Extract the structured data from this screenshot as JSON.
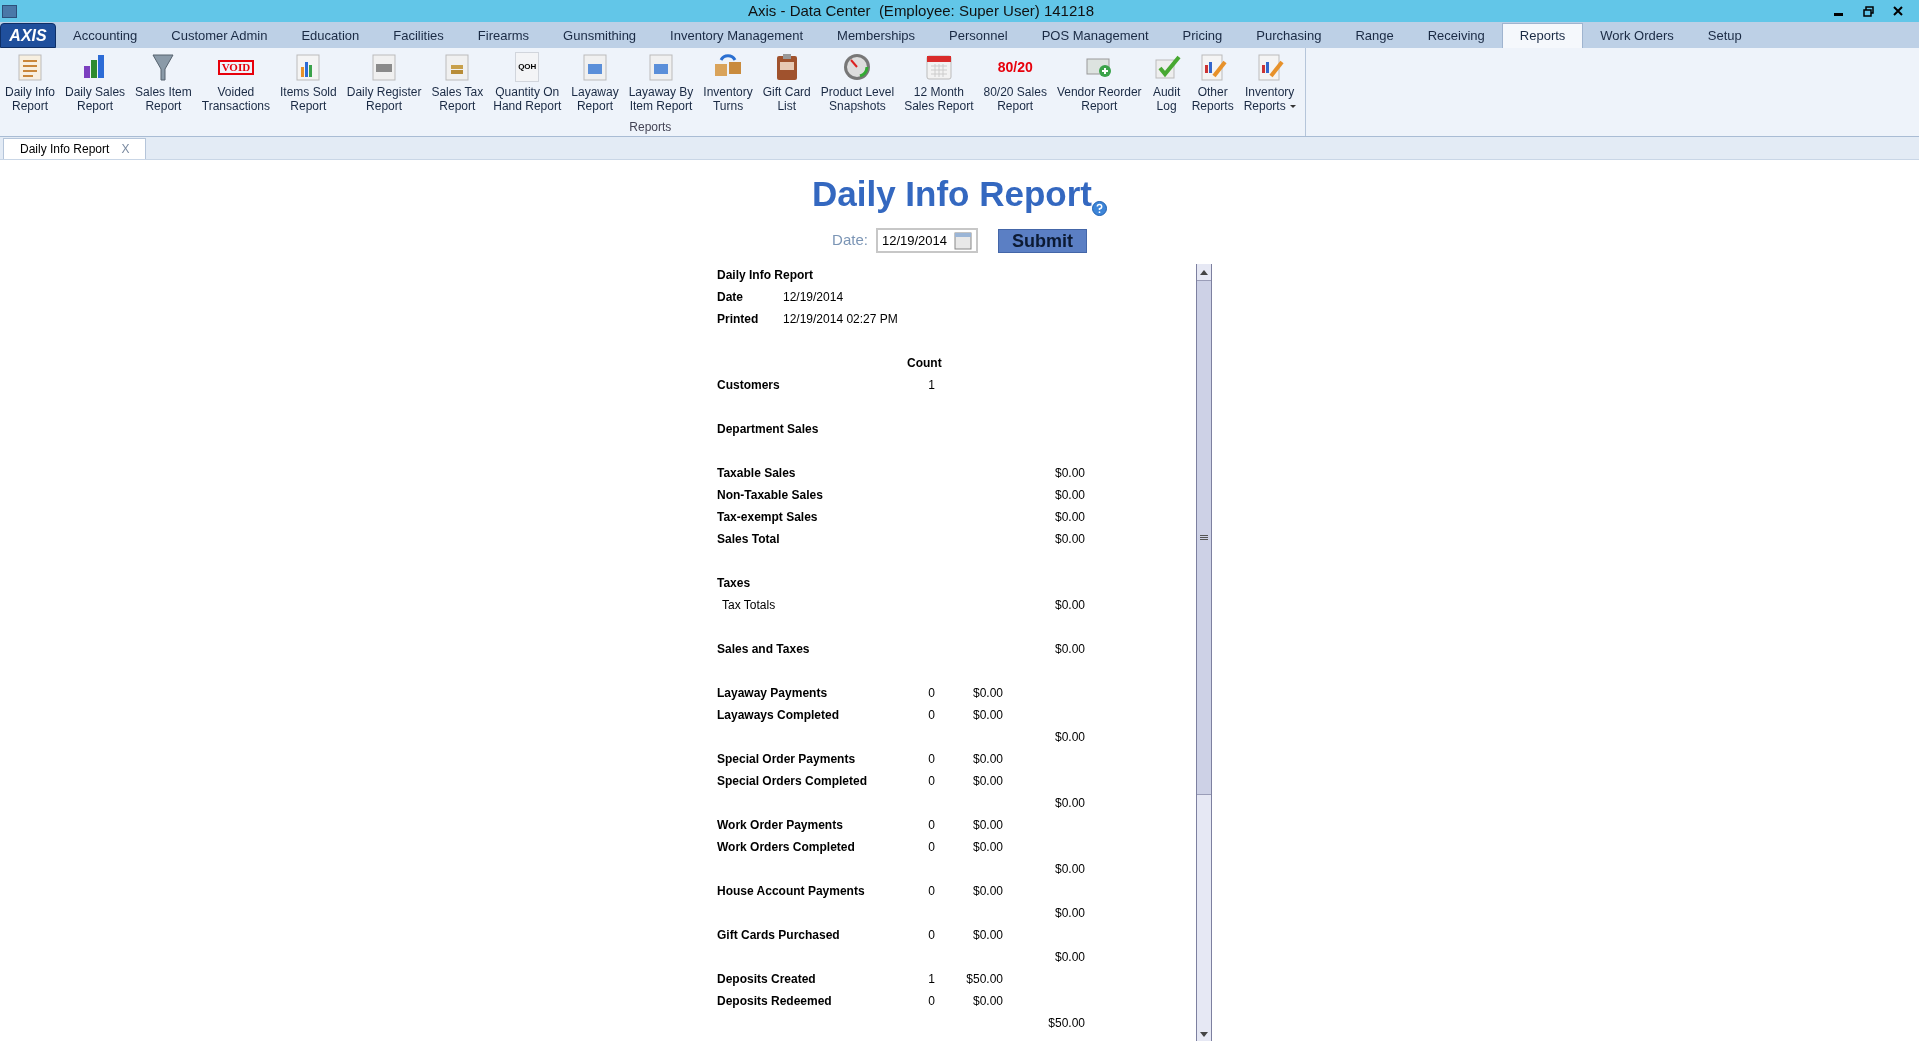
{
  "window": {
    "title": "Axis - Data Center  (Employee: Super User) 141218",
    "logo": "AXIS"
  },
  "menu_tabs": [
    {
      "label": "Accounting",
      "selected": false
    },
    {
      "label": "Customer Admin",
      "selected": false
    },
    {
      "label": "Education",
      "selected": false
    },
    {
      "label": "Facilities",
      "selected": false
    },
    {
      "label": "Firearms",
      "selected": false
    },
    {
      "label": "Gunsmithing",
      "selected": false
    },
    {
      "label": "Inventory Management",
      "selected": false
    },
    {
      "label": "Memberships",
      "selected": false
    },
    {
      "label": "Personnel",
      "selected": false
    },
    {
      "label": "POS Management",
      "selected": false
    },
    {
      "label": "Pricing",
      "selected": false
    },
    {
      "label": "Purchasing",
      "selected": false
    },
    {
      "label": "Range",
      "selected": false
    },
    {
      "label": "Receiving",
      "selected": false
    },
    {
      "label": "Reports",
      "selected": true
    },
    {
      "label": "Work Orders",
      "selected": false
    },
    {
      "label": "Setup",
      "selected": false
    }
  ],
  "ribbon": {
    "group_label": "Reports",
    "items": [
      {
        "label": "Daily Info\nReport"
      },
      {
        "label": "Daily Sales\nReport"
      },
      {
        "label": "Sales Item\nReport"
      },
      {
        "label": "Voided\nTransactions",
        "icon_text": "VOID"
      },
      {
        "label": "Items Sold\nReport"
      },
      {
        "label": "Daily Register\nReport"
      },
      {
        "label": "Sales Tax\nReport"
      },
      {
        "label": "Quantity On\nHand Report",
        "icon_text": "QOH"
      },
      {
        "label": "Layaway\nReport"
      },
      {
        "label": "Layaway By\nItem Report"
      },
      {
        "label": "Inventory\nTurns"
      },
      {
        "label": "Gift Card\nList"
      },
      {
        "label": "Product Level\nSnapshots"
      },
      {
        "label": "12 Month\nSales Report"
      },
      {
        "label": "80/20 Sales\nReport",
        "icon_text": "80/20"
      },
      {
        "label": "Vendor Reorder\nReport"
      },
      {
        "label": "Audit\nLog"
      },
      {
        "label": "Other\nReports"
      },
      {
        "label": "Inventory\nReports",
        "dropdown": true
      }
    ]
  },
  "document_tabs": [
    {
      "label": "Daily Info Report",
      "close": "X",
      "selected": true
    }
  ],
  "report": {
    "title": "Daily Info Report",
    "date_label": "Date:",
    "date_value": "12/19/2014",
    "submit": "Submit",
    "rows": [
      {
        "kind": "title",
        "label": "Daily Info Report"
      },
      {
        "kind": "info",
        "label": "Date",
        "value": "12/19/2014"
      },
      {
        "kind": "info",
        "label": "Printed",
        "value": "12/19/2014 02:27 PM"
      },
      {
        "kind": "blank"
      },
      {
        "kind": "column_header",
        "count": "Count"
      },
      {
        "kind": "line",
        "label": "Customers",
        "count": "1"
      },
      {
        "kind": "blank"
      },
      {
        "kind": "line",
        "label": "Department Sales"
      },
      {
        "kind": "blank"
      },
      {
        "kind": "line",
        "label": "Taxable Sales",
        "total": "$0.00"
      },
      {
        "kind": "line",
        "label": "Non-Taxable Sales",
        "total": "$0.00"
      },
      {
        "kind": "line",
        "label": "Tax-exempt Sales",
        "total": "$0.00"
      },
      {
        "kind": "line",
        "label": "Sales Total",
        "total": "$0.00"
      },
      {
        "kind": "blank"
      },
      {
        "kind": "line",
        "label": "Taxes"
      },
      {
        "kind": "indent",
        "label": "Tax Totals",
        "total": "$0.00"
      },
      {
        "kind": "blank"
      },
      {
        "kind": "line",
        "label": "Sales and Taxes",
        "total": "$0.00"
      },
      {
        "kind": "blank"
      },
      {
        "kind": "line",
        "label": "Layaway Payments",
        "count": "0",
        "amount": "$0.00"
      },
      {
        "kind": "line",
        "label": "Layaways Completed",
        "count": "0",
        "amount": "$0.00"
      },
      {
        "kind": "line",
        "total": "$0.00"
      },
      {
        "kind": "line",
        "label": "Special Order Payments",
        "count": "0",
        "amount": "$0.00"
      },
      {
        "kind": "line",
        "label": "Special Orders Completed",
        "count": "0",
        "amount": "$0.00"
      },
      {
        "kind": "line",
        "total": "$0.00"
      },
      {
        "kind": "line",
        "label": "Work Order Payments",
        "count": "0",
        "amount": "$0.00"
      },
      {
        "kind": "line",
        "label": "Work Orders Completed",
        "count": "0",
        "amount": "$0.00"
      },
      {
        "kind": "line",
        "total": "$0.00"
      },
      {
        "kind": "line",
        "label": "House Account Payments",
        "count": "0",
        "amount": "$0.00"
      },
      {
        "kind": "line",
        "total": "$0.00"
      },
      {
        "kind": "line",
        "label": "Gift Cards Purchased",
        "count": "0",
        "amount": "$0.00"
      },
      {
        "kind": "line",
        "total": "$0.00"
      },
      {
        "kind": "line",
        "label": "Deposits Created",
        "count": "1",
        "amount": "$50.00"
      },
      {
        "kind": "line",
        "label": "Deposits Redeemed",
        "count": "0",
        "amount": "$0.00"
      },
      {
        "kind": "line",
        "total": "$50.00"
      }
    ]
  }
}
